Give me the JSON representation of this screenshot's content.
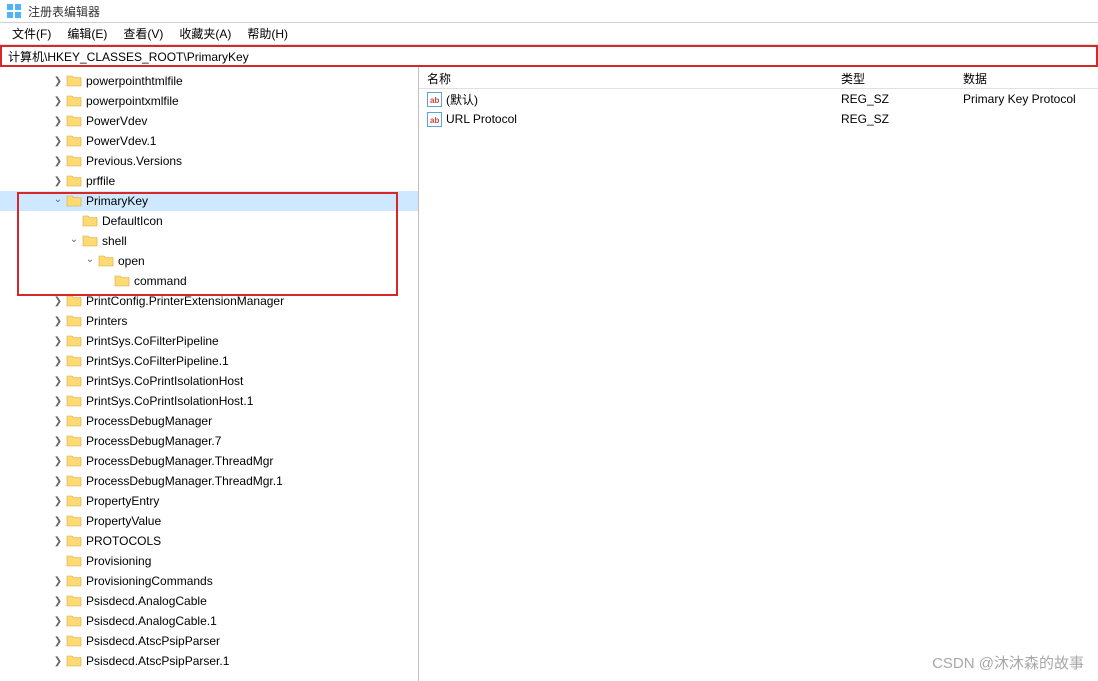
{
  "window": {
    "title": "注册表编辑器"
  },
  "menu": {
    "file": "文件(F)",
    "edit": "编辑(E)",
    "view": "查看(V)",
    "favorites": "收藏夹(A)",
    "help": "帮助(H)"
  },
  "addressbar": {
    "path": "计算机\\HKEY_CLASSES_ROOT\\PrimaryKey"
  },
  "tree": {
    "items": [
      {
        "label": "powerpointhtmlfile",
        "depth": 2,
        "expander": "closed"
      },
      {
        "label": "powerpointxmlfile",
        "depth": 2,
        "expander": "closed"
      },
      {
        "label": "PowerVdev",
        "depth": 2,
        "expander": "closed"
      },
      {
        "label": "PowerVdev.1",
        "depth": 2,
        "expander": "closed"
      },
      {
        "label": "Previous.Versions",
        "depth": 2,
        "expander": "closed"
      },
      {
        "label": "prffile",
        "depth": 2,
        "expander": "closed"
      },
      {
        "label": "PrimaryKey",
        "depth": 2,
        "expander": "open",
        "selected": true
      },
      {
        "label": "DefaultIcon",
        "depth": 3,
        "expander": "none"
      },
      {
        "label": "shell",
        "depth": 3,
        "expander": "open"
      },
      {
        "label": "open",
        "depth": 4,
        "expander": "open"
      },
      {
        "label": "command",
        "depth": 5,
        "expander": "none"
      },
      {
        "label": "PrintConfig.PrinterExtensionManager",
        "depth": 2,
        "expander": "closed"
      },
      {
        "label": "Printers",
        "depth": 2,
        "expander": "closed"
      },
      {
        "label": "PrintSys.CoFilterPipeline",
        "depth": 2,
        "expander": "closed"
      },
      {
        "label": "PrintSys.CoFilterPipeline.1",
        "depth": 2,
        "expander": "closed"
      },
      {
        "label": "PrintSys.CoPrintIsolationHost",
        "depth": 2,
        "expander": "closed"
      },
      {
        "label": "PrintSys.CoPrintIsolationHost.1",
        "depth": 2,
        "expander": "closed"
      },
      {
        "label": "ProcessDebugManager",
        "depth": 2,
        "expander": "closed"
      },
      {
        "label": "ProcessDebugManager.7",
        "depth": 2,
        "expander": "closed"
      },
      {
        "label": "ProcessDebugManager.ThreadMgr",
        "depth": 2,
        "expander": "closed"
      },
      {
        "label": "ProcessDebugManager.ThreadMgr.1",
        "depth": 2,
        "expander": "closed"
      },
      {
        "label": "PropertyEntry",
        "depth": 2,
        "expander": "closed"
      },
      {
        "label": "PropertyValue",
        "depth": 2,
        "expander": "closed"
      },
      {
        "label": "PROTOCOLS",
        "depth": 2,
        "expander": "closed"
      },
      {
        "label": "Provisioning",
        "depth": 2,
        "expander": "none"
      },
      {
        "label": "ProvisioningCommands",
        "depth": 2,
        "expander": "closed"
      },
      {
        "label": "Psisdecd.AnalogCable",
        "depth": 2,
        "expander": "closed"
      },
      {
        "label": "Psisdecd.AnalogCable.1",
        "depth": 2,
        "expander": "closed"
      },
      {
        "label": "Psisdecd.AtscPsipParser",
        "depth": 2,
        "expander": "closed"
      },
      {
        "label": "Psisdecd.AtscPsipParser.1",
        "depth": 2,
        "expander": "closed"
      }
    ]
  },
  "list": {
    "columns": {
      "name": "名称",
      "type": "类型",
      "data": "数据"
    },
    "rows": [
      {
        "name": "(默认)",
        "type": "REG_SZ",
        "data": "Primary Key Protocol"
      },
      {
        "name": "URL Protocol",
        "type": "REG_SZ",
        "data": ""
      }
    ]
  },
  "watermark": "CSDN @沐沐森的故事"
}
